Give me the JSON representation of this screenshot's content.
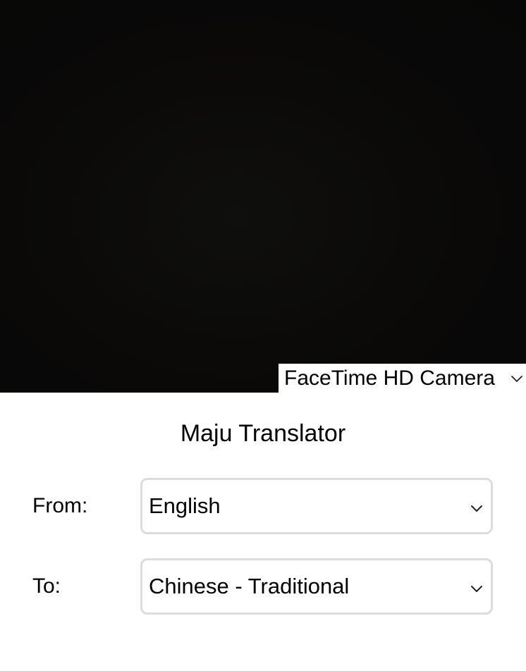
{
  "camera": {
    "source_label": "FaceTime HD Camera",
    "chevron_icon": "chevron-down-icon"
  },
  "app": {
    "title": "Maju Translator"
  },
  "from": {
    "label": "From:",
    "value": "English",
    "chevron_icon": "chevron-down-icon"
  },
  "to": {
    "label": "To:",
    "value": "Chinese - Traditional",
    "chevron_icon": "chevron-down-icon"
  }
}
